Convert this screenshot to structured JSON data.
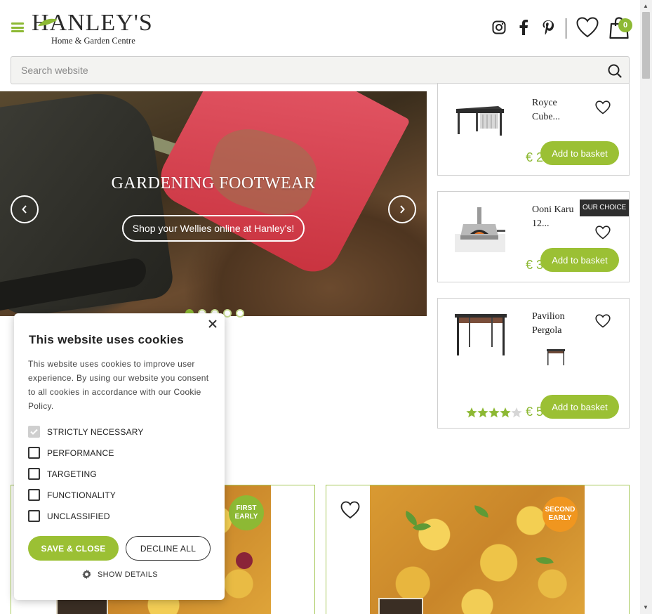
{
  "header": {
    "logo_main": "HANLEY'S",
    "logo_sub": "Home & Garden Centre",
    "search_placeholder": "Search website",
    "basket_count": "0",
    "icons": [
      "menu-icon",
      "instagram-icon",
      "facebook-icon",
      "pinterest-icon",
      "heart-icon",
      "basket-icon",
      "search-icon"
    ]
  },
  "hero": {
    "title": "GARDENING FOOTWEAR",
    "button": "Shop your Wellies online at Hanley's!",
    "dots": 5,
    "active_dot": 0
  },
  "products": [
    {
      "name": "Royce Cube...",
      "price": "€ 2",
      "button": "Add to basket"
    },
    {
      "name": "Ooni Karu 12...",
      "price": "€ 3",
      "button": "Add to basket",
      "badge": "OUR CHOICE"
    },
    {
      "name": "Pavilion Pergola",
      "price": "€ 5",
      "button": "Add to basket",
      "rating": 4
    }
  ],
  "promos": [
    {
      "badge": "FIRST EARLY"
    },
    {
      "badge": "SECOND EARLY"
    }
  ],
  "cookie": {
    "title": "This website uses cookies",
    "text": "This website uses cookies to improve user experience. By using our website you consent to all cookies in accordance with our Cookie Policy.",
    "options": [
      {
        "label": "STRICTLY NECESSARY",
        "checked": true
      },
      {
        "label": "PERFORMANCE",
        "checked": false
      },
      {
        "label": "TARGETING",
        "checked": false
      },
      {
        "label": "FUNCTIONALITY",
        "checked": false
      },
      {
        "label": "UNCLASSIFIED",
        "checked": false
      }
    ],
    "save_label": "SAVE & CLOSE",
    "decline_label": "DECLINE ALL",
    "details_label": "SHOW DETAILS"
  },
  "colors": {
    "accent": "#9bc034",
    "dark": "#2e2e2e"
  }
}
